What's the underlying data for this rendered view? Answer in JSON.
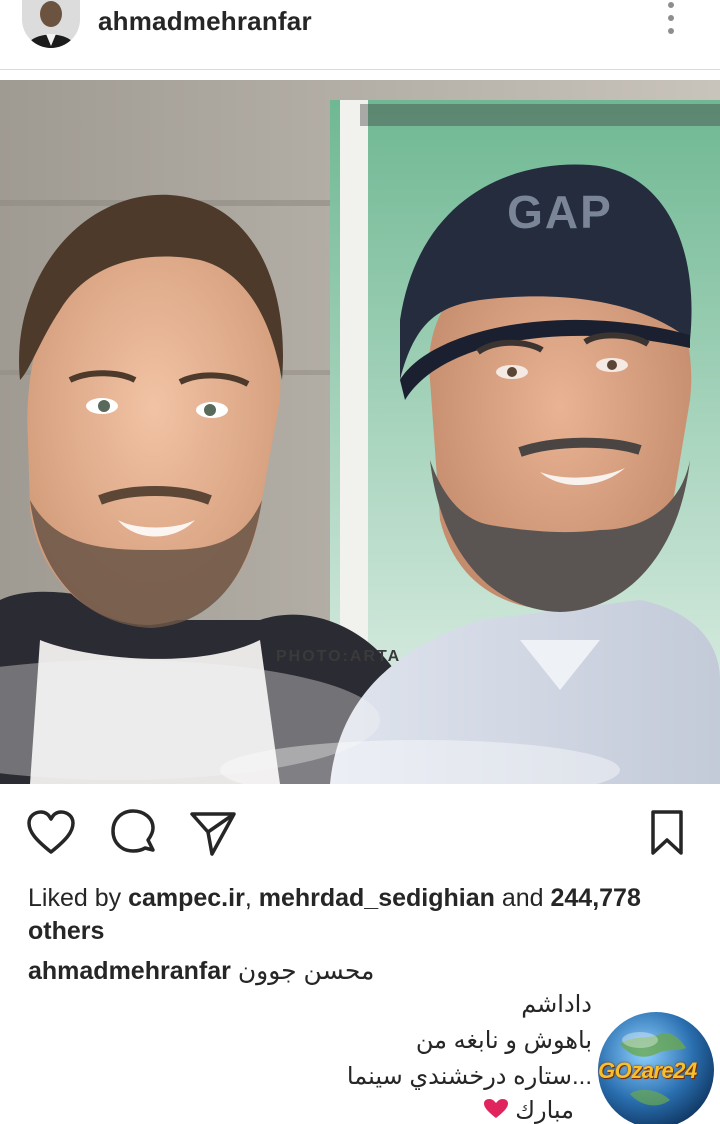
{
  "header": {
    "username": "ahmadmehranfar",
    "avatar_icon": "profile-avatar",
    "more_icon": "more-vertical-icon"
  },
  "photo": {
    "watermark": "PHOTO:ARTA",
    "cap_text": "GAP"
  },
  "actions": {
    "like_icon": "heart-icon",
    "comment_icon": "comment-icon",
    "share_icon": "send-icon",
    "save_icon": "bookmark-icon"
  },
  "likes": {
    "prefix": "Liked by ",
    "user1": "campec.ir",
    "sep": ", ",
    "user2": "mehrdad_sedighian",
    "and": " and ",
    "count": "244,778",
    "others": "others"
  },
  "caption": {
    "username": "ahmadmehranfar",
    "text": "محسن جوون",
    "lines": [
      "داداشم",
      "باهوش و نابغه من",
      "...ستاره درخشندي سينما",
      "مبارك"
    ]
  },
  "logo": {
    "text": "GOzare24"
  },
  "colors": {
    "text": "#262626",
    "secondary": "#8e8e8e",
    "heart": "#e0245e",
    "logo_gold": "#f6c02b",
    "logo_blue": "#2a6fb0"
  }
}
